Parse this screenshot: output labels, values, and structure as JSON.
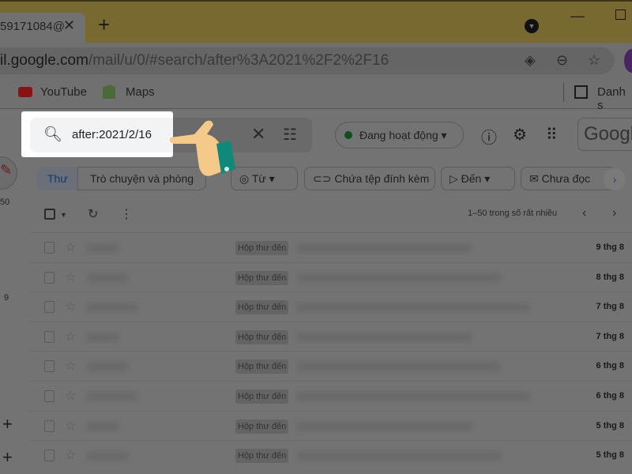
{
  "browser": {
    "tab_title": "59171084@",
    "url_host": "il.google.com",
    "url_path": "/mail/u/0/#search/after%3A2021%2F2%2F16",
    "bookmarks": [
      {
        "label": "YouTube",
        "icon": "youtube-icon"
      },
      {
        "label": "Maps",
        "icon": "maps-icon"
      }
    ],
    "reading_list": "Danh s"
  },
  "search": {
    "query": "after:2021/2/16"
  },
  "header": {
    "status": "Đang hoạt động",
    "status_color": "#1e8e3e",
    "logo": "Googl"
  },
  "filters": {
    "seg1": "Thư",
    "seg2": "Trò chuyện và phòng",
    "chips": [
      "Từ",
      "Chứa tệp đính kèm",
      "Đến",
      "Chưa đọc"
    ]
  },
  "sidebar": {
    "count1": "50",
    "count2": "9"
  },
  "list": {
    "range": "1–50 trong số rất nhiều",
    "rows": [
      {
        "label": "Hộp thư đến",
        "date": "9 thg 8"
      },
      {
        "label": "Hộp thư đến",
        "date": "8 thg 8"
      },
      {
        "label": "Hộp thư đến",
        "date": "7 thg 8"
      },
      {
        "label": "Hộp thư đến",
        "date": "7 thg 8"
      },
      {
        "label": "Hộp thư đến",
        "date": "6 thg 8"
      },
      {
        "label": "Hộp thư đến",
        "date": "6 thg 8"
      },
      {
        "label": "Hộp thư đến",
        "date": "5 thg 8"
      },
      {
        "label": "Hộp thư đến",
        "date": "5 thg 8"
      }
    ]
  }
}
